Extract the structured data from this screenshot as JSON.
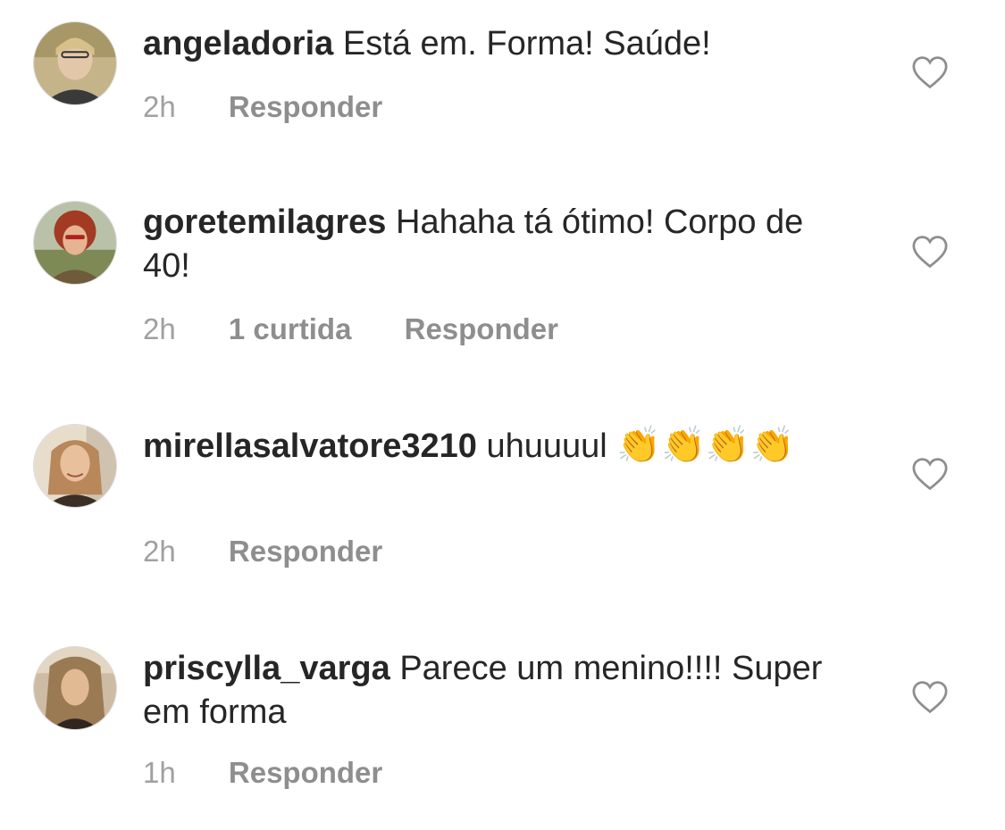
{
  "comments": [
    {
      "username": "angeladoria",
      "text": "Está em. Forma! Saúde!",
      "time": "2h",
      "likes": "",
      "reply_label": "Responder",
      "avatar_colors": [
        "#8a7a4e",
        "#d9c9a3",
        "#5b4a36"
      ]
    },
    {
      "username": "goretemilagres",
      "text": "Hahaha tá ótimo! Corpo de 40!",
      "time": "2h",
      "likes": "1 curtida",
      "reply_label": "Responder",
      "avatar_colors": [
        "#9b3a2a",
        "#e2b38c",
        "#6d7d4a"
      ]
    },
    {
      "username": "mirellasalvatore3210",
      "text": "uhuuuul",
      "emoji": "👏👏👏👏",
      "time": "2h",
      "likes": "",
      "reply_label": "Responder",
      "avatar_colors": [
        "#c9a58a",
        "#e7c7a8",
        "#4a3a2e"
      ]
    },
    {
      "username": "priscylla_varga",
      "text": "Parece um menino!!!! Super em forma",
      "time": "1h",
      "likes": "",
      "reply_label": "Responder",
      "avatar_colors": [
        "#8c7a66",
        "#d8bfa4",
        "#3f3229"
      ]
    }
  ],
  "icons": {
    "like": "heart-outline-icon"
  },
  "colors": {
    "text": "#262626",
    "secondary": "#8e8e8e",
    "icon": "#8e8e8e"
  }
}
